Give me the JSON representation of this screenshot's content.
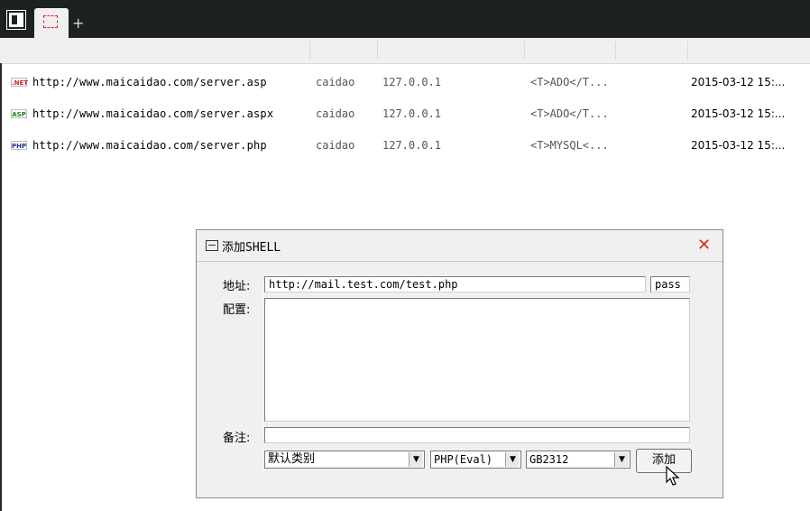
{
  "tabs": {
    "add_symbol": "+"
  },
  "table": {
    "rows": [
      {
        "type_icon": ".NET",
        "type_color": "#d02020",
        "url": "http://www.maicaidao.com/server.asp",
        "category": "caidao",
        "ip": "127.0.0.1",
        "db": "<T>ADO</T...",
        "time": "2015-03-12 15:..."
      },
      {
        "type_icon": "ASP",
        "type_color": "#208020",
        "url": "http://www.maicaidao.com/server.aspx",
        "category": "caidao",
        "ip": "127.0.0.1",
        "db": "<T>ADO</T...",
        "time": "2015-03-12 15:..."
      },
      {
        "type_icon": "PHP",
        "type_color": "#203090",
        "url": "http://www.maicaidao.com/server.php",
        "category": "caidao",
        "ip": "127.0.0.1",
        "db": "<T>MYSQL<...",
        "time": "2015-03-12 15:..."
      }
    ]
  },
  "dialog": {
    "title": "添加SHELL",
    "close_symbol": "✕",
    "address_label": "地址:",
    "address_value": "http://mail.test.com/test.php",
    "password_value": "pass",
    "config_label": "配置:",
    "config_value": "",
    "note_label": "备注:",
    "note_value": "",
    "category_select": "默认类别",
    "type_select": "PHP(Eval)",
    "encoding_select": "GB2312",
    "add_button": "添加",
    "dropdown_arrow": "▼"
  },
  "colors": {
    "topbar": "#1c2220",
    "close": "#e02020",
    "dialog_bg": "#f0f0f0"
  }
}
